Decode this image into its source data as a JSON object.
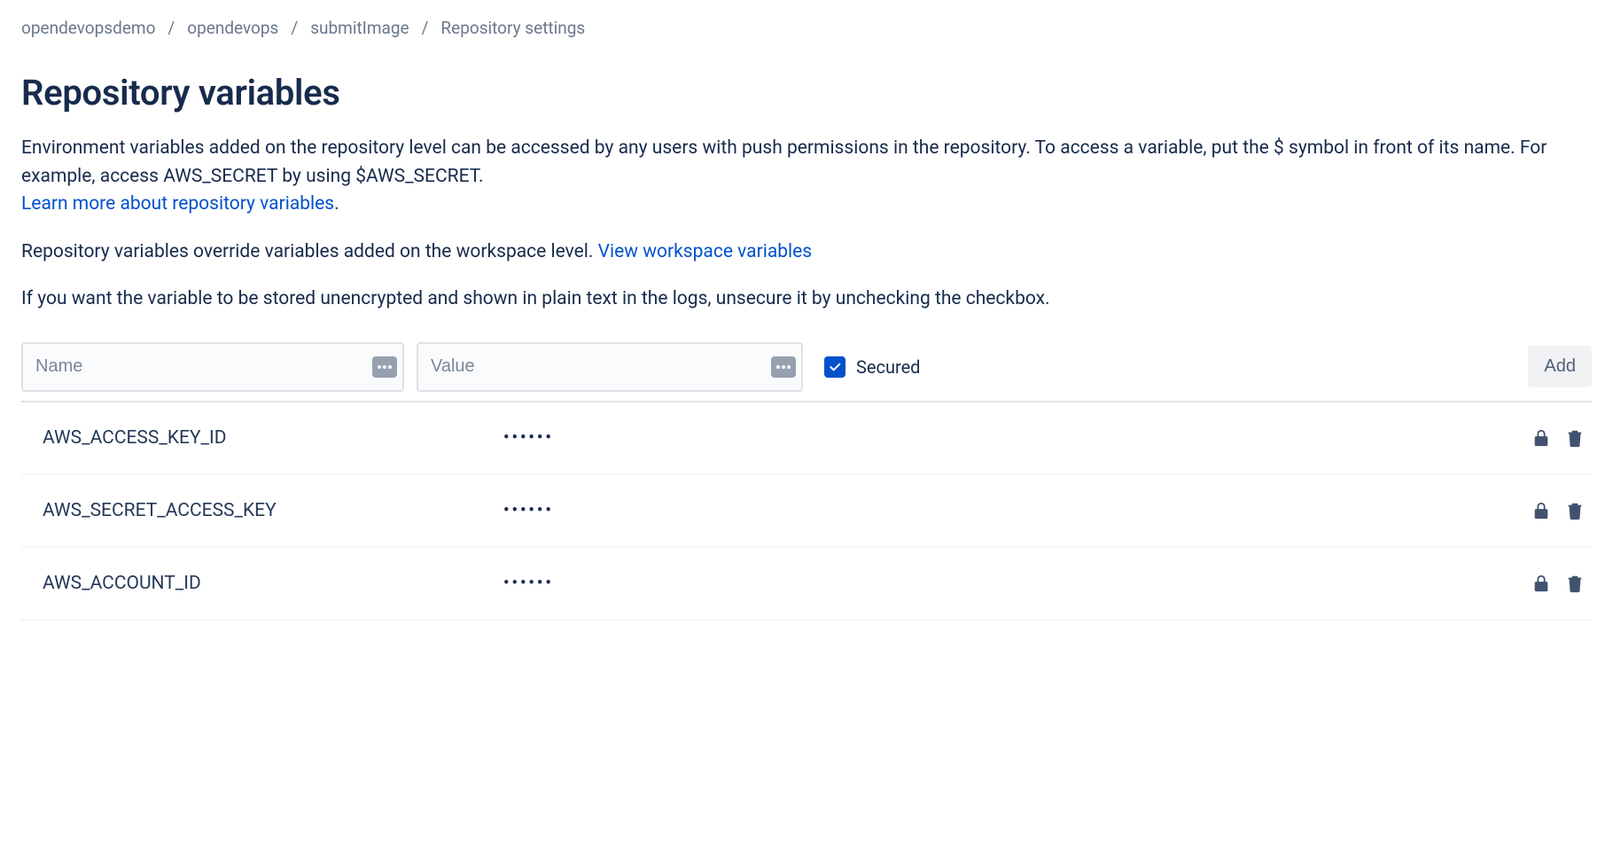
{
  "breadcrumb": {
    "items": [
      "opendevopsdemo",
      "opendevops",
      "submitImage",
      "Repository settings"
    ]
  },
  "title": "Repository variables",
  "desc1_part1": "Environment variables added on the repository level can be accessed by any users with push permissions in the repository. To access a variable, put the $ symbol in front of its name. For example, access AWS_SECRET by using $AWS_SECRET.",
  "desc1_link": "Learn more about repository variables",
  "desc1_tail": ".",
  "desc2_part1": "Repository variables override variables added on the workspace level. ",
  "desc2_link": "View workspace variables",
  "desc3": "If you want the variable to be stored unencrypted and shown in plain text in the logs, unsecure it by unchecking the checkbox.",
  "form": {
    "name_placeholder": "Name",
    "value_placeholder": "Value",
    "secured_label": "Secured",
    "add_label": "Add"
  },
  "variables": [
    {
      "name": "AWS_ACCESS_KEY_ID",
      "value": "••••••"
    },
    {
      "name": "AWS_SECRET_ACCESS_KEY",
      "value": "••••••"
    },
    {
      "name": "AWS_ACCOUNT_ID",
      "value": "••••••"
    }
  ]
}
